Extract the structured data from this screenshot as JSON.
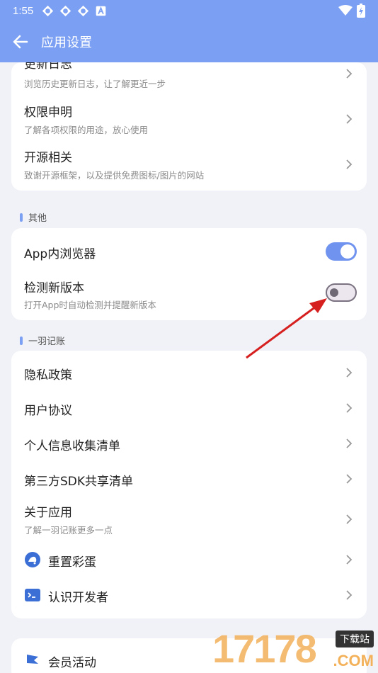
{
  "status_bar": {
    "time": "1:55",
    "notif_icons": [
      "sync-icon",
      "sync-icon",
      "sync-icon",
      "a-icon"
    ],
    "wifi": "wifi-icon",
    "battery": "battery-charging-icon"
  },
  "app_bar": {
    "title": "应用设置",
    "back_icon": "arrow-left-icon"
  },
  "card_top": {
    "items": [
      {
        "title": "更新日志",
        "subtitle": "浏览历史更新日志，让了解更近一步"
      },
      {
        "title": "权限申明",
        "subtitle": "了解各项权限的用途，放心使用"
      },
      {
        "title": "开源相关",
        "subtitle": "致谢开源框架，以及提供免费图标/图片的网站"
      }
    ]
  },
  "section_other": {
    "label": "其他"
  },
  "card_other": {
    "items": [
      {
        "title": "App内浏览器",
        "toggle": "on"
      },
      {
        "title": "检测新版本",
        "subtitle": "打开App时自动检测并提醒新版本",
        "toggle": "off"
      }
    ]
  },
  "section_app": {
    "label": "一羽记账"
  },
  "card_app": {
    "items": [
      {
        "title": "隐私政策"
      },
      {
        "title": "用户协议"
      },
      {
        "title": "个人信息收集清单"
      },
      {
        "title": "第三方SDK共享清单"
      },
      {
        "title": "关于应用",
        "subtitle": "了解一羽记账更多一点"
      },
      {
        "title": "重置彩蛋",
        "icon": "egg-icon"
      },
      {
        "title": "认识开发者",
        "icon": "terminal-icon"
      }
    ]
  },
  "card_member": {
    "items": [
      {
        "title": "会员活动",
        "icon": "flag-icon"
      }
    ]
  },
  "watermark": {
    "number": "17178",
    "tag": "下载站",
    "domain": ".COM"
  },
  "colors": {
    "primary": "#7b9ff2",
    "toggle_on": "#6f93ee",
    "annotation_arrow": "#d62020"
  }
}
